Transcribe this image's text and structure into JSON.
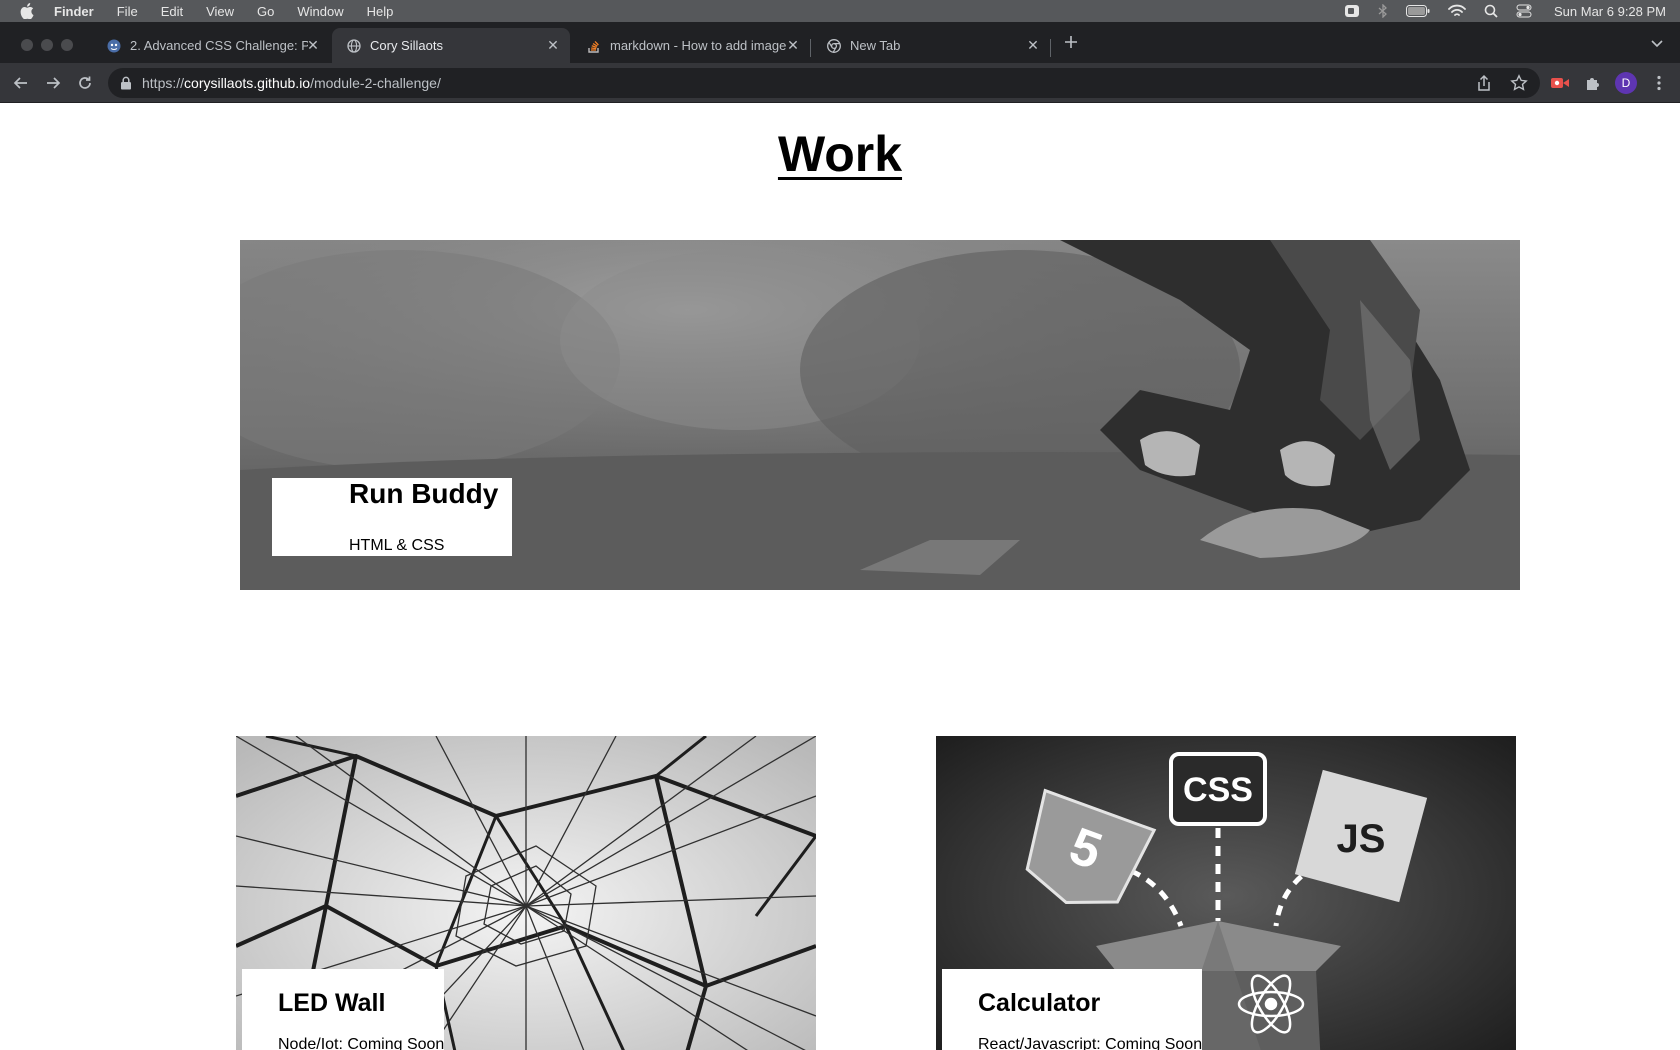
{
  "menubar": {
    "items": [
      "Finder",
      "File",
      "Edit",
      "View",
      "Go",
      "Window",
      "Help"
    ],
    "clock": "Sun Mar 6  9:28 PM"
  },
  "tabs": [
    {
      "label": "2. Advanced CSS Challenge: P",
      "icon": "github-icon",
      "active": false
    },
    {
      "label": "Cory Sillaots",
      "icon": "globe-icon",
      "active": true
    },
    {
      "label": "markdown - How to add image",
      "icon": "stackoverflow-icon",
      "active": false
    },
    {
      "label": "New Tab",
      "icon": "chrome-icon",
      "active": false
    }
  ],
  "address": {
    "scheme": "https://",
    "host": "corysillaots.github.io",
    "path": "/module-2-challenge/"
  },
  "profile_initial": "D",
  "page": {
    "heading": "Work",
    "projects": [
      {
        "title": "Run Buddy",
        "subtitle": "HTML & CSS",
        "image": "runner-tying-shoe"
      },
      {
        "title": "LED Wall",
        "subtitle": "Node/Iot: Coming Soon",
        "image": "geometric-wire-structure"
      },
      {
        "title": "Calculator",
        "subtitle": "React/Javascript: Coming Soon",
        "image": "web-tech-logos-box"
      }
    ]
  },
  "colors": {
    "menubar_bg": "#56585b",
    "tabstrip_bg": "#202124",
    "toolbar_bg": "#35363a",
    "page_bg": "#ffffff"
  }
}
